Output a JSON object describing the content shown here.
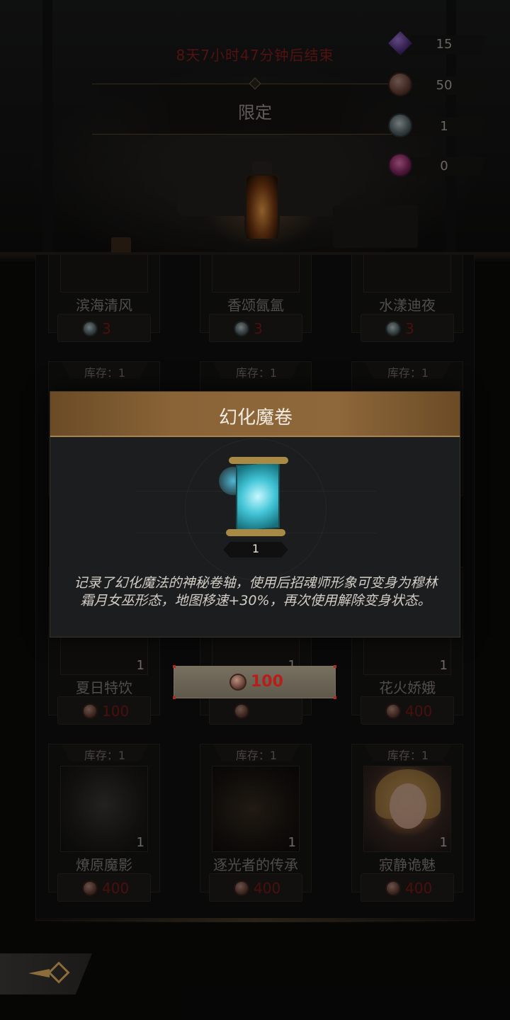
{
  "header": {
    "timer": "8天7小时47分钟后结束",
    "tab_label": "限定"
  },
  "currencies": [
    {
      "icon": "purple-crystal-icon",
      "value": "15"
    },
    {
      "icon": "bronze-coin-icon",
      "value": "50"
    },
    {
      "icon": "silver-token-icon",
      "value": "1"
    },
    {
      "icon": "rose-emblem-icon",
      "value": "0"
    }
  ],
  "shop": {
    "row1": [
      {
        "name": "滨海清风",
        "price": "3",
        "currency_icon": "silver-token-icon"
      },
      {
        "name": "香颂氤氲",
        "price": "3",
        "currency_icon": "silver-token-icon"
      },
      {
        "name": "水漾迪夜",
        "price": "3",
        "currency_icon": "silver-token-icon"
      }
    ],
    "row2_stock": [
      "库存：1",
      "库存：1",
      "库存：1"
    ],
    "row3": [
      {
        "name": "夏日特饮",
        "qty": "1",
        "price": "100",
        "currency_icon": "bronze-coin-icon"
      },
      {
        "name": "",
        "qty": "1",
        "price": "",
        "currency_icon": "bronze-coin-icon"
      },
      {
        "name": "花火娇娥",
        "qty": "1",
        "price": "400",
        "currency_icon": "bronze-coin-icon"
      }
    ],
    "row4": [
      {
        "stock": "库存：1",
        "name": "燎原魔影",
        "qty": "1",
        "price": "400",
        "currency_icon": "bronze-coin-icon"
      },
      {
        "stock": "库存：1",
        "name": "逐光者的传承",
        "qty": "1",
        "price": "400",
        "currency_icon": "bronze-coin-icon"
      },
      {
        "stock": "库存：1",
        "name": "寂静诡魅",
        "qty": "1",
        "price": "400",
        "currency_icon": "bronze-coin-icon"
      }
    ]
  },
  "popup": {
    "title": "幻化魔卷",
    "item_icon": "magic-scroll-icon",
    "item_qty": "1",
    "description": "记录了幻化魔法的神秘卷轴，使用后招魂师形象可变身为穆林霜月女巫形态，地图移速+30%，再次使用解除变身状态。"
  },
  "buy_button": {
    "price": "100",
    "currency_icon": "bronze-coin-icon"
  },
  "colors": {
    "price_red": "#7e1a17",
    "buy_red": "#b91d19",
    "header_gold": "#8e673a",
    "timer_red": "#8e1f1b"
  }
}
